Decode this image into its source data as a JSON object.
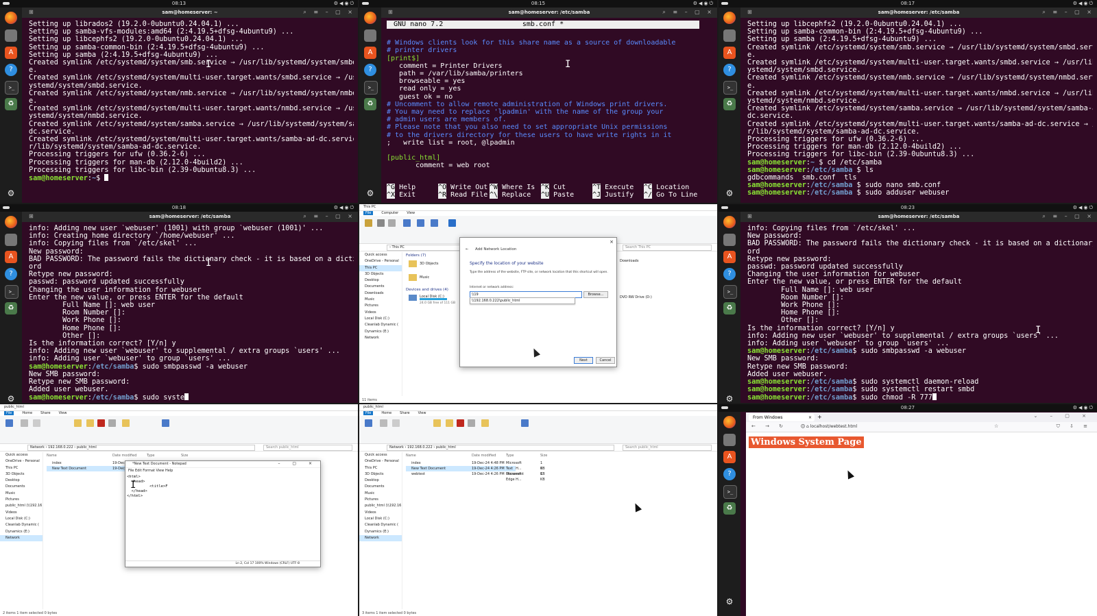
{
  "panels": {
    "p1": {
      "clock": "08:13",
      "title": "sam@homeserver: ~",
      "lines": [
        "Setting up librados2 (19.2.0-0ubuntu0.24.04.1) ...",
        "Setting up samba-vfs-modules:amd64 (2:4.19.5+dfsg-4ubuntu9) ...",
        "Setting up libcephfs2 (19.2.0-0ubuntu0.24.04.1) ...",
        "Setting up samba-common-bin (2:4.19.5+dfsg-4ubuntu9) ...",
        "Setting up samba (2:4.19.5+dfsg-4ubuntu9) ...",
        "Created symlink /etc/systemd/system/smb.service → /usr/lib/systemd/system/smbd.servic",
        "e.",
        "Created symlink /etc/systemd/system/multi-user.target.wants/smbd.service → /usr/lib/s",
        "ystemd/system/smbd.service.",
        "Created symlink /etc/systemd/system/nmb.service → /usr/lib/systemd/system/nmbd.servic",
        "e.",
        "Created symlink /etc/systemd/system/multi-user.target.wants/nmbd.service → /usr/lib/s",
        "ystemd/system/nmbd.service.",
        "Created symlink /etc/systemd/system/samba.service → /usr/lib/systemd/system/samba-ad-",
        "dc.service.",
        "Created symlink /etc/systemd/system/multi-user.target.wants/samba-ad-dc.service → /us",
        "r/lib/systemd/system/samba-ad-dc.service.",
        "Processing triggers for ufw (0.36.2-6) ...",
        "Processing triggers for man-db (2.12.0-4build2) ...",
        "Processing triggers for libc-bin (2.39-0ubuntu8.3) ..."
      ],
      "prompt_user": "sam@homeserver",
      "prompt_path": "~",
      "prompt_cmd": ""
    },
    "p2": {
      "clock": "08:15",
      "title": "sam@homeserver: /etc/samba",
      "nano_version": "GNU nano 7.2",
      "nano_file": "smb.conf *",
      "lines": [
        {
          "t": "",
          "c": ""
        },
        {
          "t": "# Windows clients look for this share name as a source of downloadable",
          "c": "c-comment"
        },
        {
          "t": "# printer drivers",
          "c": "c-comment"
        },
        {
          "t": "[print$]",
          "c": "c-sect"
        },
        {
          "t": "   comment = Printer Drivers",
          "c": ""
        },
        {
          "t": "   path = /var/lib/samba/printers",
          "c": ""
        },
        {
          "t": "   browseable = yes",
          "c": ""
        },
        {
          "t": "   read only = yes",
          "c": ""
        },
        {
          "t": "   guest ok = no",
          "c": ""
        },
        {
          "t": "# Uncomment to allow remote administration of Windows print drivers.",
          "c": "c-comment"
        },
        {
          "t": "# You may need to replace 'lpadmin' with the name of the group your",
          "c": "c-comment"
        },
        {
          "t": "# admin users are members of.",
          "c": "c-comment"
        },
        {
          "t": "# Please note that you also need to set appropriate Unix permissions",
          "c": "c-comment"
        },
        {
          "t": "# to the drivers directory for these users to have write rights in it",
          "c": "c-comment"
        },
        {
          "t": ";   write list = root, @lpadmin",
          "c": ""
        },
        {
          "t": "",
          "c": ""
        },
        {
          "t": "[public_html]",
          "c": "c-sect"
        },
        {
          "t": "       comment = web root",
          "c": ""
        }
      ],
      "keys": [
        {
          "k": "^G",
          "l": "Help"
        },
        {
          "k": "^O",
          "l": "Write Out"
        },
        {
          "k": "^W",
          "l": "Where Is"
        },
        {
          "k": "^K",
          "l": "Cut"
        },
        {
          "k": "^T",
          "l": "Execute"
        },
        {
          "k": "^C",
          "l": "Location"
        },
        {
          "k": "^X",
          "l": "Exit"
        },
        {
          "k": "^R",
          "l": "Read File"
        },
        {
          "k": "^\\",
          "l": "Replace"
        },
        {
          "k": "^U",
          "l": "Paste"
        },
        {
          "k": "^J",
          "l": "Justify"
        },
        {
          "k": "^/",
          "l": "Go To Line"
        }
      ]
    },
    "p3": {
      "clock": "08:17",
      "title": "sam@homeserver: /etc/samba",
      "lines": [
        "Setting up libcephfs2 (19.2.0-0ubuntu0.24.04.1) ...",
        "Setting up samba-common-bin (2:4.19.5+dfsg-4ubuntu9) ...",
        "Setting up samba (2:4.19.5+dfsg-4ubuntu9) ...",
        "Created symlink /etc/systemd/system/smb.service → /usr/lib/systemd/system/smbd.servic",
        "e.",
        "Created symlink /etc/systemd/system/multi-user.target.wants/smbd.service → /usr/lib/s",
        "ystemd/system/smbd.service.",
        "Created symlink /etc/systemd/system/nmb.service → /usr/lib/systemd/system/nmbd.servic",
        "e.",
        "Created symlink /etc/systemd/system/multi-user.target.wants/nmbd.service → /usr/lib/s",
        "ystemd/system/nmbd.service.",
        "Created symlink /etc/systemd/system/samba.service → /usr/lib/systemd/system/samba-ad-",
        "dc.service.",
        "Created symlink /etc/systemd/system/multi-user.target.wants/samba-ad-dc.service → /us",
        "r/lib/systemd/system/samba-ad-dc.service.",
        "Processing triggers for ufw (0.36.2-6) ...",
        "Processing triggers for man-db (2.12.0-4build2) ...",
        "Processing triggers for libc-bin (2.39-0ubuntu8.3) ..."
      ],
      "prompts": [
        {
          "path": "~",
          "cmd": "$ cd /etc/samba"
        },
        {
          "path": "/etc/samba",
          "cmd": "$ ls"
        },
        {
          "out": "gdbcommands  smb.conf  tls"
        },
        {
          "path": "/etc/samba",
          "cmd": "$ sudo nano smb.conf"
        },
        {
          "path": "/etc/samba",
          "cmd": "$ sudo adduser webuser"
        }
      ]
    },
    "p4": {
      "clock": "08:18",
      "title": "sam@homeserver: /etc/samba",
      "lines": [
        "info: Adding new user `webuser' (1001) with group `webuser (1001)' ...",
        "info: Creating home directory `/home/webuser' ...",
        "info: Copying files from `/etc/skel' ...",
        "New password:",
        "BAD PASSWORD: The password fails the dictionary check - it is based on a dictionary w",
        "ord",
        "Retype new password:",
        "passwd: password updated successfully",
        "Changing the user information for webuser",
        "Enter the new value, or press ENTER for the default",
        "        Full Name []: web user",
        "        Room Number []:",
        "        Work Phone []:",
        "        Home Phone []:",
        "        Other []:",
        "Is the information correct? [Y/n] y",
        "info: Adding new user `webuser' to supplemental / extra groups `users' ...",
        "info: Adding user `webuser' to group `users' ..."
      ],
      "p1_cmd": "$ sudo smbpasswd -a webuser",
      "after": [
        "New SMB password:",
        "Retype new SMB password:",
        "Added user webuser."
      ],
      "p2_cmd": "$ sudo syste"
    },
    "p6": {
      "clock": "08:23",
      "title": "sam@homeserver: /etc/samba",
      "lines": [
        "info: Copying files from `/etc/skel' ...",
        "New password:",
        "BAD PASSWORD: The password fails the dictionary check - it is based on a dictionary w",
        "ord",
        "Retype new password:",
        "passwd: password updated successfully",
        "Changing the user information for webuser",
        "Enter the new value, or press ENTER for the default",
        "        Full Name []: web user",
        "        Room Number []:",
        "        Work Phone []:",
        "        Home Phone []:",
        "        Other []:",
        "Is the information correct? [Y/n] y",
        "info: Adding new user `webuser' to supplemental / extra groups `users' ...",
        "info: Adding user `webuser' to group `users' ..."
      ],
      "c1": "$ sudo smbpasswd -a webuser",
      "after": [
        "New SMB password:",
        "Retype new SMB password:",
        "Added user webuser."
      ],
      "c2": "$ sudo systemctl daemon-reload",
      "c3": "$ sudo systemctl restart smbd",
      "c4": "$ sudo chmod -R 777"
    },
    "p9": {
      "clock": "08:27",
      "tab_title": "From Windows",
      "url": "localhost/webtest.html",
      "page_heading": "Windows System Page"
    }
  },
  "explorer": {
    "tabs": [
      "File",
      "Computer",
      "View"
    ],
    "tabs_home": [
      "File",
      "Home",
      "Share",
      "View"
    ],
    "this_pc_path": "This PC",
    "search_this_pc": "Search This PC",
    "nav": [
      "Quick access",
      "OneDrive - Personal",
      "This PC",
      "3D Objects",
      "Desktop",
      "Documents",
      "Downloads",
      "Music",
      "Pictures",
      "Videos",
      "Local Disk (C:)",
      "Cleanlab Dynamic (",
      "Dynamics (E:)",
      "Network"
    ],
    "folders_group": "Folders (7)",
    "folders": [
      "3D Objects",
      "Music"
    ],
    "devices_group": "Devices and drives (4)",
    "local_disk": "Local Disk (C:)",
    "local_disk_free": "24.0 GB free of 111 GB",
    "downloads": "Downloads",
    "dvd": "DVD RW Drive (D:)",
    "status_7": "11 items",
    "dialog": {
      "title": "Add Network Location",
      "heading": "Specify the location of your website",
      "desc": "Type the address of the website, FTP site, or network location that this shortcut will open.",
      "label": "Internet or network address:",
      "value": "\\\\19",
      "suggest": "\\\\192.168.0.222\\public_html",
      "browse": "Browse...",
      "next": "Next",
      "cancel": "Cancel"
    },
    "net_path": [
      "Network",
      "192.168.0.222",
      "public_html"
    ],
    "search_public": "Search public_html",
    "cols": [
      "Name",
      "Date modified",
      "Type",
      "Size"
    ],
    "rows_a": [
      {
        "name": "index",
        "date": "19-Dec-24 4:48 PM",
        "type": "Microsoft Edge H...",
        "size": "1 KB"
      },
      {
        "name": "New Text Document",
        "date": "19-Dec-24 4:26 PM",
        "type": "Text Document",
        "size": "0 KB"
      }
    ],
    "rows_b": [
      {
        "name": "index",
        "date": "19-Dec-24 4:48 PM",
        "type": "Microsoft Edge H...",
        "size": "1 KB"
      },
      {
        "name": "New Text Document",
        "date": "19-Dec-24 4:26 PM",
        "type": "Text Document",
        "size": "0 KB"
      },
      {
        "name": "webtest",
        "date": "19-Dec-24 4:26 PM",
        "type": "Microsoft Edge H...",
        "size": "1 KB"
      }
    ],
    "nav_net": [
      "Quick access",
      "OneDrive - Personal",
      "This PC",
      "3D Objects",
      "Desktop",
      "Documents",
      "Music",
      "Pictures",
      "public_html (\\\\192.16",
      "Videos",
      "Local Disk (C:)",
      "Cleanlab Dynamic (",
      "Dynamics (E:)",
      "Network"
    ],
    "status_a": "2 items   1 item selected  0 bytes",
    "status_b": "3 items   1 item selected  0 bytes",
    "notepad": {
      "title": "*New Text Document - Notepad",
      "menu": [
        "File",
        "Edit",
        "Format",
        "View",
        "Help"
      ],
      "text": "<html>\n  <head>\n          <title>F\n  </head>\n</html>",
      "status": "Ln 2, Col 17     100%     Windows (CRLF)     UTF-8"
    }
  }
}
